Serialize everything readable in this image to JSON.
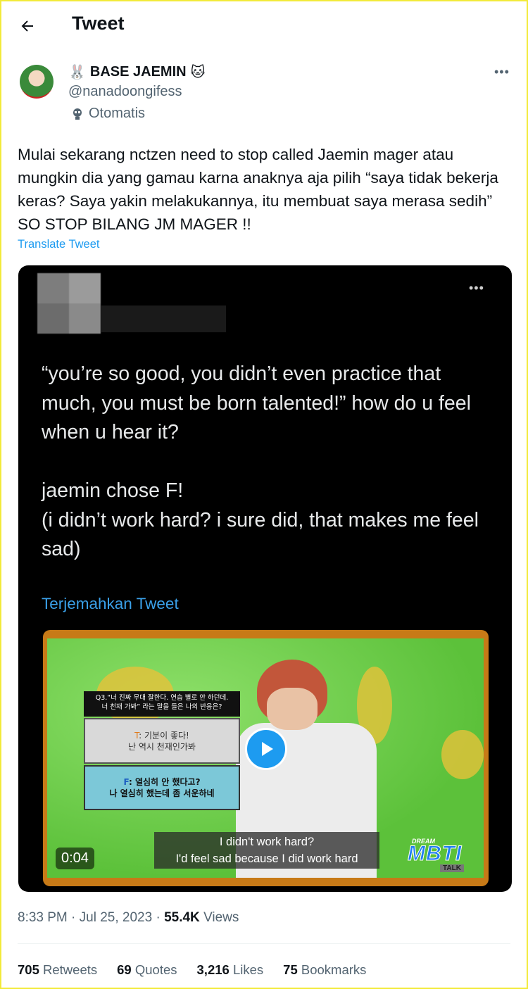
{
  "header": {
    "title": "Tweet",
    "back_icon": "arrow-left-icon"
  },
  "author": {
    "name": "BASE JAEMIN",
    "name_prefix_emoji": "🐰",
    "name_suffix_emoji": "🐱",
    "handle": "@nanadoongifess",
    "automated_label": "Otomatis"
  },
  "tweet": {
    "text": "Mulai sekarang nctzen need to stop called Jaemin mager atau mungkin dia yang gamau karna anaknya aja pilih “saya tidak bekerja keras? Saya yakin melakukannya, itu membuat saya merasa sedih” SO STOP BILANG JM MAGER !!",
    "translate_label": "Translate Tweet"
  },
  "embedded": {
    "text": "“you’re so good, you didn’t even practice that much, you must be born talented!” how do u feel when u hear it?\n\njaemin chose F!\n(i didn’t work hard? i sure did, that makes me feel sad)",
    "translate_label": "Terjemahkan Tweet",
    "video": {
      "duration": "0:04",
      "quiz_question_line1": "Q3.“너 진짜 무대 잘한다. 연습 별로 안 하던데.",
      "quiz_question_line2": "너 천재 가봐” 라는 말을 들은 나의 반응은?",
      "option_t_letter": "T",
      "option_t_line1": ": 기분이 좋다!",
      "option_t_line2": "난 역시 천재인가봐",
      "option_f_letter": "F",
      "option_f_line1": ": 열심히 안 했다고?",
      "option_f_line2": "나 열심히 했는데 좀 서운하네",
      "subtitle_line1": "I didn't work hard?",
      "subtitle_line2": "I'd feel sad because I did work hard",
      "logo_dream": "DREAM",
      "logo_mbti": "MBTI",
      "logo_talk": "TALK"
    }
  },
  "meta": {
    "time": "8:33 PM",
    "separator": " · ",
    "date": "Jul 25, 2023",
    "views_count": "55.4K",
    "views_label": "Views"
  },
  "stats": {
    "retweets_count": "705",
    "retweets_label": "Retweets",
    "quotes_count": "69",
    "quotes_label": "Quotes",
    "likes_count": "3,216",
    "likes_label": "Likes",
    "bookmarks_count": "75",
    "bookmarks_label": "Bookmarks"
  },
  "colors": {
    "accent": "#1d9bf0",
    "border": "#f2ea3a"
  }
}
